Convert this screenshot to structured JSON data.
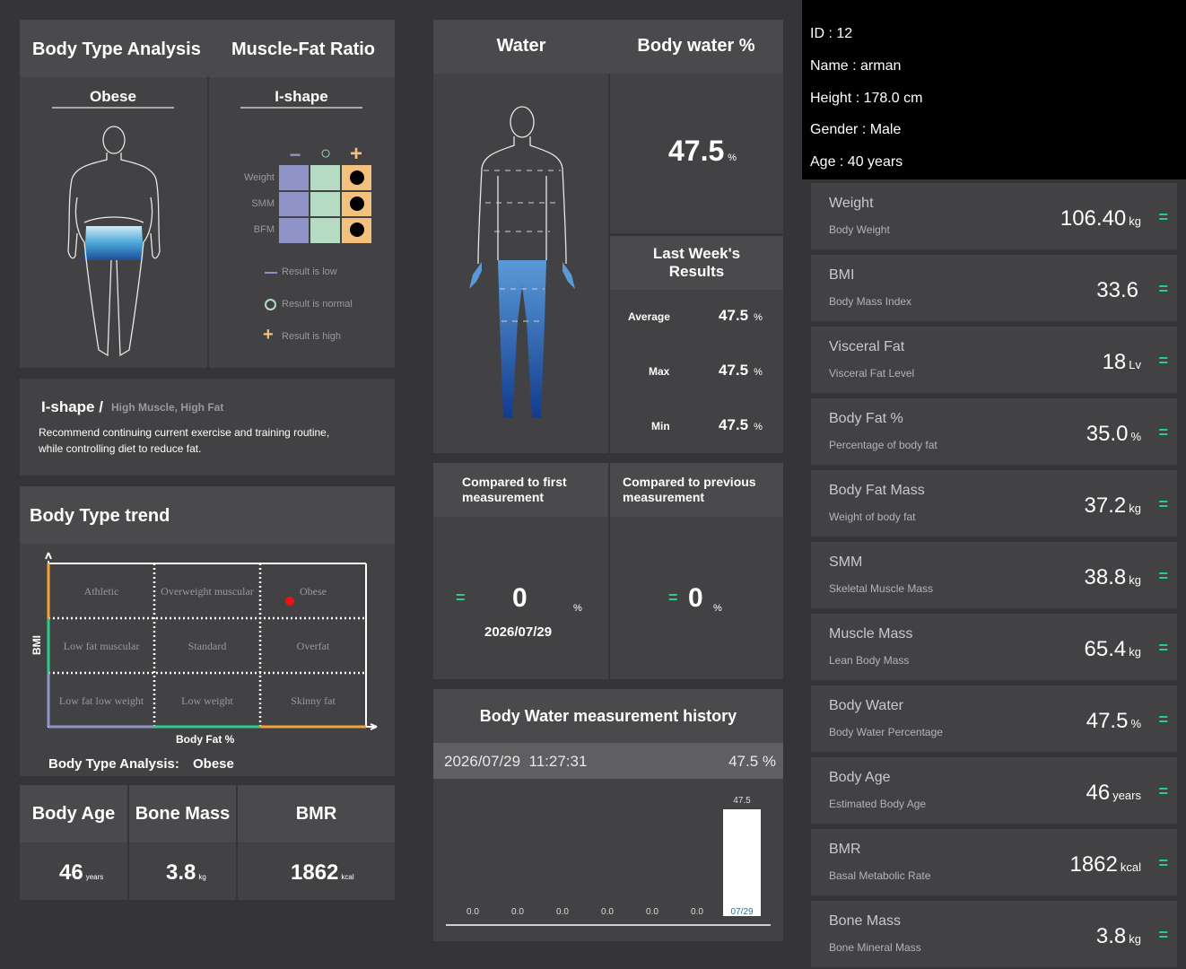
{
  "left_top": {
    "title_body_type": "Body Type Analysis",
    "title_muscle_fat": "Muscle-Fat Ratio",
    "body_type": "Obese",
    "shape": "I-shape",
    "symbols": {
      "low": "−",
      "normal": "○",
      "high": "+"
    },
    "rows": [
      "Weight",
      "SMM",
      "BFM"
    ],
    "legend_low": "Result is low",
    "legend_normal": "Result is normal",
    "legend_high": "Result is high",
    "colors": {
      "low": "#8f93c7",
      "normal": "#b6dcc4",
      "high": "#f3c17c"
    }
  },
  "recommend": {
    "shape": "I-shape /",
    "subtitle": "High Muscle, High Fat",
    "text_line1": "Recommend continuing current exercise and training routine,",
    "text_line2": "while controlling diet to reduce fat."
  },
  "trend": {
    "title": "Body Type trend",
    "cells": [
      "Athletic",
      "Overweight muscular",
      "Obese",
      "Low fat muscular",
      "Standard",
      "Overfat",
      "Low fat low weight",
      "Low weight",
      "Skinny fat"
    ],
    "ylabel": "BMI",
    "xlabel": "Body Fat %",
    "result_label": "Body Type Analysis:",
    "result_value": "Obese"
  },
  "bottom_left": {
    "body_age_title": "Body Age",
    "body_age_value": "46",
    "body_age_unit": "years",
    "bone_mass_title": "Bone Mass",
    "bone_mass_value": "3.8",
    "bone_mass_unit": "kg",
    "bmr_title": "BMR",
    "bmr_value": "1862",
    "bmr_unit": "kcal"
  },
  "water": {
    "title": "Water",
    "title_pct": "Body water %",
    "value": "47.5",
    "unit": "%",
    "last_week_title_1": "Last Week's",
    "last_week_title_2": "Results",
    "average_label": "Average",
    "average_value": "47.5",
    "max_label": "Max",
    "max_value": "47.5",
    "min_label": "Min",
    "min_value": "47.5",
    "pct": "%"
  },
  "compare": {
    "first_title_1": "Compared to first",
    "first_title_2": "measurement",
    "first_value": "0",
    "first_date": "2026/07/29",
    "prev_title_1": "Compared to previous",
    "prev_title_2": "measurement",
    "prev_value": "0",
    "eq": "=",
    "pct": "%"
  },
  "history": {
    "title": "Body Water measurement history",
    "row_date": "2026/07/29  11:27:31",
    "row_value": "47.5 %"
  },
  "chart_data": {
    "type": "bar",
    "categories": [
      "",
      "",
      "",
      "",
      "",
      "",
      "07/29"
    ],
    "values": [
      0.0,
      0.0,
      0.0,
      0.0,
      0.0,
      0.0,
      47.5
    ],
    "value_labels": [
      "0.0",
      "0.0",
      "0.0",
      "0.0",
      "0.0",
      "0.0",
      "47.5"
    ],
    "ylim": [
      0,
      47.5
    ]
  },
  "profile": {
    "id": "ID : 12",
    "name": "Name : arman",
    "height": "Height : 178.0 cm",
    "gender": "Gender : Male",
    "age": "Age : 40 years"
  },
  "metrics": [
    {
      "title": "Weight",
      "sub": "Body Weight",
      "value": "106.40",
      "unit": "kg",
      "status": "="
    },
    {
      "title": "BMI",
      "sub": "Body Mass Index",
      "value": "33.6",
      "unit": "",
      "status": "="
    },
    {
      "title": "Visceral Fat",
      "sub": "Visceral Fat Level",
      "value": "18",
      "unit": "Lv",
      "status": "="
    },
    {
      "title": "Body Fat %",
      "sub": "Percentage of body fat",
      "value": "35.0",
      "unit": "%",
      "status": "="
    },
    {
      "title": "Body Fat Mass",
      "sub": "Weight of body fat",
      "value": "37.2",
      "unit": "kg",
      "status": "="
    },
    {
      "title": "SMM",
      "sub": "Skeletal Muscle Mass",
      "value": "38.8",
      "unit": "kg",
      "status": "="
    },
    {
      "title": "Muscle Mass",
      "sub": "Lean Body Mass",
      "value": "65.4",
      "unit": "kg",
      "status": "="
    },
    {
      "title": "Body Water",
      "sub": "Body Water Percentage",
      "value": "47.5",
      "unit": "%",
      "status": "="
    },
    {
      "title": "Body Age",
      "sub": "Estimated Body Age",
      "value": "46",
      "unit": "years",
      "status": "="
    },
    {
      "title": "BMR",
      "sub": "Basal Metabolic Rate",
      "value": "1862",
      "unit": "kcal",
      "status": "="
    },
    {
      "title": "Bone Mass",
      "sub": "Bone Mineral Mass",
      "value": "3.8",
      "unit": "kg",
      "status": "="
    }
  ]
}
